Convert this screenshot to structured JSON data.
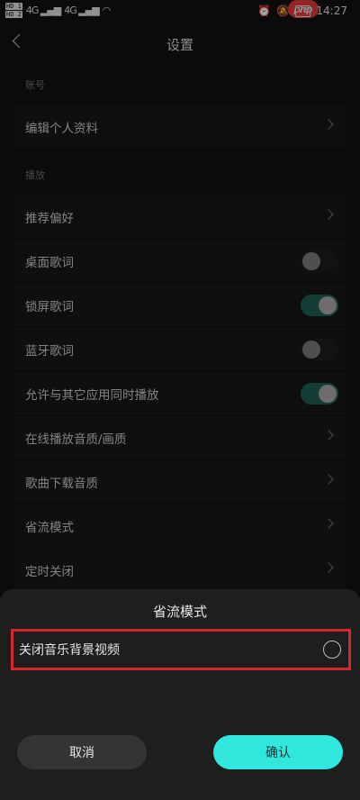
{
  "status_bar": {
    "hd1": "HD 1",
    "hd2": "HD 2",
    "sig1": "4G",
    "sig2": "4G",
    "battery": "78",
    "time": "14:27",
    "watermark": "php"
  },
  "header": {
    "title": "设置"
  },
  "sections": {
    "account": "账号",
    "playback": "播放"
  },
  "rows": [
    {
      "label": "编辑个人资料",
      "control": "chevron"
    },
    {
      "label": "推荐偏好",
      "control": "chevron"
    },
    {
      "label": "桌面歌词",
      "control": "toggle",
      "on": false
    },
    {
      "label": "锁屏歌词",
      "control": "toggle",
      "on": true
    },
    {
      "label": "蓝牙歌词",
      "control": "toggle",
      "on": false
    },
    {
      "label": "允许与其它应用同时播放",
      "control": "toggle",
      "on": true
    },
    {
      "label": "在线播放音质/画质",
      "control": "chevron"
    },
    {
      "label": "歌曲下载音质",
      "control": "chevron"
    },
    {
      "label": "省流模式",
      "control": "chevron"
    },
    {
      "label": "定时关闭",
      "control": "chevron"
    }
  ],
  "sheet": {
    "title": "省流模式",
    "option_label": "关闭音乐背景视频",
    "option_selected": false,
    "cancel_label": "取消",
    "confirm_label": "确认"
  },
  "colors": {
    "accent": "#2fe7dd",
    "highlight_border": "#d9262c",
    "toggle_on": "#1f5f55"
  }
}
